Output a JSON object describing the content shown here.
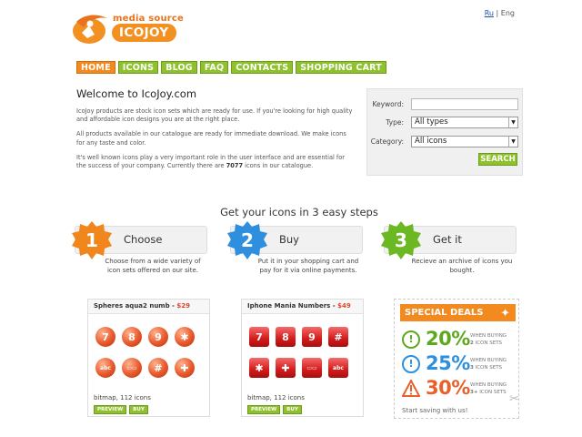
{
  "brand": {
    "tagline": "media source",
    "name": "ICOJOY"
  },
  "lang": {
    "ru": "Ru",
    "sep": "|",
    "en": "Eng"
  },
  "nav": {
    "items": [
      "HOME",
      "ICONS",
      "BLOG",
      "FAQ",
      "CONTACTS",
      "SHOPPING CART"
    ]
  },
  "welcome": {
    "title": "Welcome to IcoJoy.com",
    "p1": "IcoJoy products are stock icon sets which are ready for use. If you're looking for high quality and affordable icon designs you are at the right place.",
    "p2": "All products available in our catalogue are ready for immediate download. We make icons for any taste and color.",
    "p3_before": "It's well known icons play a very important role in the user interface and are essential for the success of your company. Currently there are ",
    "p3_count": "7077",
    "p3_after": " icons in our catalogue."
  },
  "search": {
    "keyword_label": "Keyword:",
    "keyword_value": "",
    "type_label": "Type:",
    "type_value": "All types",
    "category_label": "Category:",
    "category_value": "All icons",
    "button": "SEARCH"
  },
  "steps": {
    "title": "Get your icons in 3 easy steps",
    "items": [
      {
        "num": "1",
        "label": "Choose",
        "desc": "Choose from a wide variety of icon sets offered on our site.",
        "color": "#f0861c"
      },
      {
        "num": "2",
        "label": "Buy",
        "desc": "Put it in your shopping cart and pay for it via online payments.",
        "color": "#2d8fde"
      },
      {
        "num": "3",
        "label": "Get it",
        "desc": "Recieve an archive of icons you bought.",
        "color": "#6cb823"
      }
    ]
  },
  "products": [
    {
      "name": "Spheres aqua2 numb",
      "price": "$29",
      "meta": "bitmap, 112 icons",
      "icons": [
        "7",
        "8",
        "9",
        "✱",
        "abc",
        "▭▭",
        "#",
        "✚"
      ],
      "preview": "PREVIEW",
      "buy": "BUY"
    },
    {
      "name": "Iphone Mania Numbers",
      "price": "$49",
      "meta": "bitmap, 112 icons",
      "icons": [
        "7",
        "8",
        "9",
        "#",
        "✱",
        "✚",
        "▭▭",
        "abc"
      ],
      "preview": "PREVIEW",
      "buy": "BUY"
    }
  ],
  "deals": {
    "title": "SPECIAL DEALS",
    "rows": [
      {
        "pct": "20%",
        "count": "2",
        "color": "#5da91c",
        "icon": "!"
      },
      {
        "pct": "25%",
        "count": "3",
        "color": "#2d8fde",
        "icon": "!"
      },
      {
        "pct": "30%",
        "count": "3+",
        "color": "#e8602a",
        "icon": "!"
      }
    ],
    "note_prefix": "WHEN BUYING",
    "note_suffix": "ICON SETS",
    "footer": "Start saving with us!"
  },
  "colors": {
    "accent_orange": "#f28a20",
    "accent_green": "#8ec12d",
    "price_red": "#e0442a"
  }
}
